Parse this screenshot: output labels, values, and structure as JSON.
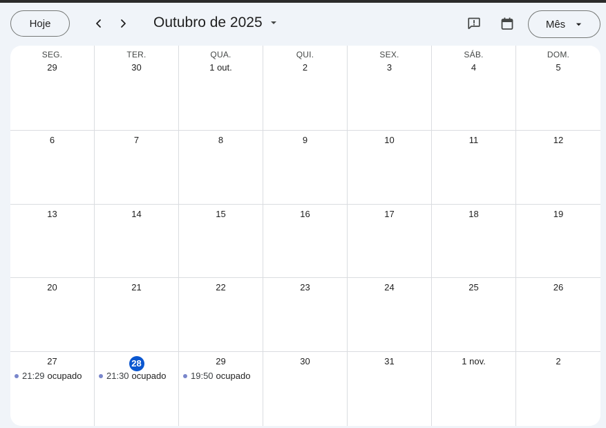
{
  "header": {
    "today_label": "Hoje",
    "month_title": "Outubro de 2025",
    "view_label": "Mês"
  },
  "icons": {
    "prev": "chevron-left-icon",
    "next": "chevron-right-icon",
    "month_dropdown": "caret-down-icon",
    "feedback": "feedback-icon",
    "calendar": "calendar-icon",
    "view_dropdown": "caret-down-icon"
  },
  "colors": {
    "today_badge": "#0b57d0",
    "event_dot": "#7986cb",
    "background": "#f0f4f9"
  },
  "weekdays": [
    "SEG.",
    "TER.",
    "QUA.",
    "QUI.",
    "SEX.",
    "SÁB.",
    "DOM."
  ],
  "weeks": [
    [
      {
        "label": "29"
      },
      {
        "label": "30"
      },
      {
        "label": "1 out."
      },
      {
        "label": "2"
      },
      {
        "label": "3"
      },
      {
        "label": "4"
      },
      {
        "label": "5"
      }
    ],
    [
      {
        "label": "6"
      },
      {
        "label": "7"
      },
      {
        "label": "8"
      },
      {
        "label": "9"
      },
      {
        "label": "10"
      },
      {
        "label": "11"
      },
      {
        "label": "12"
      }
    ],
    [
      {
        "label": "13"
      },
      {
        "label": "14"
      },
      {
        "label": "15"
      },
      {
        "label": "16"
      },
      {
        "label": "17"
      },
      {
        "label": "18"
      },
      {
        "label": "19"
      }
    ],
    [
      {
        "label": "20"
      },
      {
        "label": "21"
      },
      {
        "label": "22"
      },
      {
        "label": "23"
      },
      {
        "label": "24"
      },
      {
        "label": "25"
      },
      {
        "label": "26"
      }
    ],
    [
      {
        "label": "27",
        "events": [
          {
            "time": "21:29",
            "title": "ocupado"
          }
        ]
      },
      {
        "label": "28",
        "today": true,
        "events": [
          {
            "time": "21:30",
            "title": "ocupado"
          }
        ]
      },
      {
        "label": "29",
        "events": [
          {
            "time": "19:50",
            "title": "ocupado"
          }
        ]
      },
      {
        "label": "30"
      },
      {
        "label": "31"
      },
      {
        "label": "1 nov."
      },
      {
        "label": "2"
      }
    ]
  ]
}
